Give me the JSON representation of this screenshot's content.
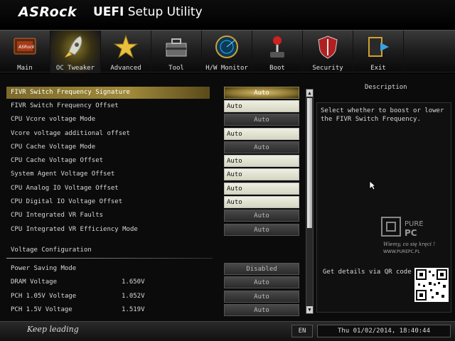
{
  "header": {
    "brand": "ASRock",
    "product_bold": "UEFI",
    "product_rest": " Setup Utility"
  },
  "tabs": [
    {
      "label": "Main",
      "icon": "main-card-icon"
    },
    {
      "label": "OC Tweaker",
      "icon": "rocket-icon"
    },
    {
      "label": "Advanced",
      "icon": "star-icon"
    },
    {
      "label": "Tool",
      "icon": "toolbox-icon"
    },
    {
      "label": "H/W Monitor",
      "icon": "radar-icon"
    },
    {
      "label": "Boot",
      "icon": "joystick-icon"
    },
    {
      "label": "Security",
      "icon": "shield-icon"
    },
    {
      "label": "Exit",
      "icon": "exit-door-icon"
    }
  ],
  "settings": [
    {
      "label": "FIVR Switch Frequency Signature",
      "value": "Auto"
    },
    {
      "label": "FIVR Switch Frequency Offset",
      "value": "Auto"
    },
    {
      "label": "CPU Vcore voltage Mode",
      "value": "Auto"
    },
    {
      "label": "Vcore voltage additional offset",
      "value": "Auto"
    },
    {
      "label": "CPU Cache Voltage Mode",
      "value": "Auto"
    },
    {
      "label": "CPU Cache Voltage Offset",
      "value": "Auto"
    },
    {
      "label": "System Agent Voltage Offset",
      "value": "Auto"
    },
    {
      "label": "CPU Analog IO Voltage Offset",
      "value": "Auto"
    },
    {
      "label": "CPU Digital IO Voltage Offset",
      "value": "Auto"
    },
    {
      "label": "CPU Integrated VR Faults",
      "value": "Auto"
    },
    {
      "label": "CPU Integrated VR Efficiency Mode",
      "value": "Auto"
    }
  ],
  "voltage_section": {
    "title": "Voltage Configuration",
    "items": [
      {
        "label": "Power Saving Mode",
        "reading": "",
        "value": "Disabled"
      },
      {
        "label": "DRAM Voltage",
        "reading": "1.650V",
        "value": "Auto"
      },
      {
        "label": "PCH 1.05V Voltage",
        "reading": "1.052V",
        "value": "Auto"
      },
      {
        "label": "PCH 1.5V Voltage",
        "reading": "1.519V",
        "value": "Auto"
      }
    ]
  },
  "description": {
    "title": "Description",
    "text": "Select whether to boost or lower the FIVR Switch Frequency.",
    "qr_label": "Get details via QR code"
  },
  "watermark": {
    "line1": "PURE",
    "line2": "PC",
    "tagline": "Wiemy, co się kręci !",
    "url": "WWW.PUREPC.PL"
  },
  "footer": {
    "slogan": "Keep leading",
    "language": "EN",
    "datetime": "Thu 01/02/2014, 18:40:44"
  },
  "colors": {
    "accent": "#a08a3a",
    "select_field": "#e6e6d6"
  }
}
